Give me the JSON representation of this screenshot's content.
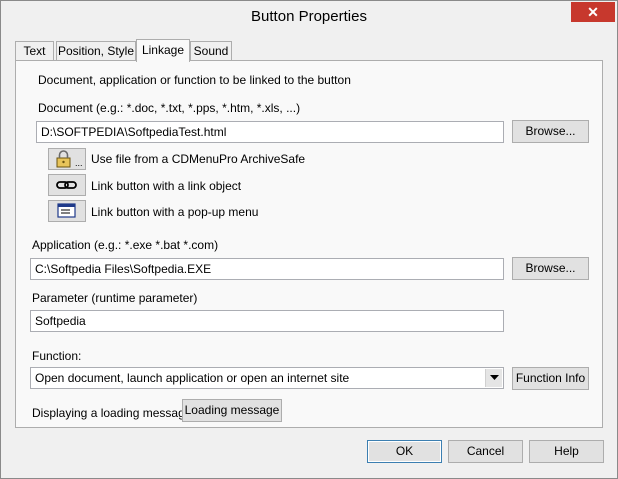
{
  "window": {
    "title": "Button Properties",
    "close_glyph": "✕"
  },
  "tabs": [
    {
      "label": "Text"
    },
    {
      "label": "Position, Style"
    },
    {
      "label": "Linkage"
    },
    {
      "label": "Sound"
    }
  ],
  "linkage": {
    "intro": "Document, application or function to be linked to the button",
    "document_label": "Document (e.g.: *.doc, *.txt, *.pps, *.htm, *.xls, ...)",
    "document_value": "D:\\SOFTPEDIA\\SoftpediaTest.html",
    "browse_label": "Browse...",
    "archivesafe_label": "Use file from a CDMenuPro ArchiveSafe",
    "link_object_label": "Link button with a link object",
    "popup_menu_label": "Link button with a pop-up menu",
    "application_label": "Application (e.g.: *.exe *.bat *.com)",
    "application_value": "C:\\Softpedia Files\\Softpedia.EXE",
    "parameter_label": "Parameter (runtime parameter)",
    "parameter_value": "Softpedia",
    "function_label": "Function:",
    "function_value": "Open document, launch application or open an internet site",
    "function_info_label": "Function Info",
    "loading_label": "Displaying a loading message",
    "loading_button_label": "Loading message"
  },
  "footer": {
    "ok_label": "OK",
    "cancel_label": "Cancel",
    "help_label": "Help"
  },
  "icons": {
    "archive": "lock-icon",
    "link": "chain-link-icon",
    "popup": "popup-menu-icon"
  }
}
